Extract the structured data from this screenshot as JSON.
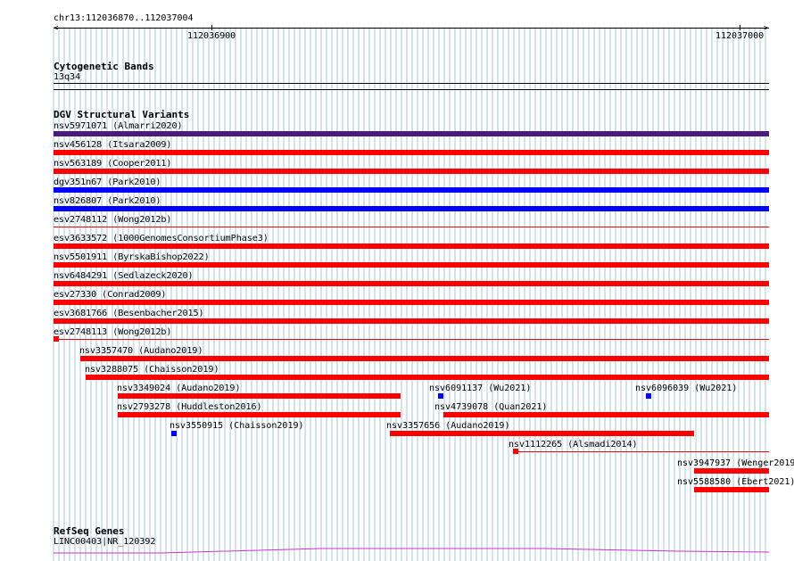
{
  "ruler": {
    "region": "chr13:112036870..112037004",
    "start_label": "112036900",
    "end_label": "112037000"
  },
  "cytoband": {
    "title": "Cytogenetic Bands",
    "band": "13q34"
  },
  "dgv": {
    "title": "DGV Structural Variants",
    "variants": [
      {
        "id": "nsv5971071",
        "study": "Almarri2020",
        "label": "nsv5971071 (Almarri2020)",
        "color": "#4b1a7a",
        "start": 112036870,
        "end": 112037004
      },
      {
        "id": "nsv456128",
        "study": "Itsara2009",
        "label": "nsv456128 (Itsara2009)",
        "color": "#ff0000",
        "start": 112036870,
        "end": 112037004
      },
      {
        "id": "nsv563189",
        "study": "Cooper2011",
        "label": "nsv563189 (Cooper2011)",
        "color": "#ff0000",
        "start": 112036870,
        "end": 112037004
      },
      {
        "id": "dgv351n67",
        "study": "Park2010",
        "label": "dgv351n67 (Park2010)",
        "color": "#0000ff",
        "start": 112036870,
        "end": 112037004
      },
      {
        "id": "nsv826807",
        "study": "Park2010",
        "label": "nsv826807 (Park2010)",
        "color": "#0000ff",
        "start": 112036870,
        "end": 112037004
      },
      {
        "id": "esv2748112",
        "study": "Wong2012b",
        "label": "esv2748112 (Wong2012b)",
        "color": "#ff0000",
        "start": 112036870,
        "end": 112037004,
        "thin": true
      },
      {
        "id": "esv3633572",
        "study": "1000GenomesConsortiumPhase3",
        "label": "esv3633572 (1000GenomesConsortiumPhase3)",
        "color": "#ff0000",
        "start": 112036870,
        "end": 112037004
      },
      {
        "id": "nsv5501911",
        "study": "ByrskaBishop2022",
        "label": "nsv5501911 (ByrskaBishop2022)",
        "color": "#ff0000",
        "start": 112036870,
        "end": 112037004
      },
      {
        "id": "nsv6484291",
        "study": "Sedlazeck2020",
        "label": "nsv6484291 (Sedlazeck2020)",
        "color": "#ff0000",
        "start": 112036870,
        "end": 112037004
      },
      {
        "id": "esv27330",
        "study": "Conrad2009",
        "label": "esv27330 (Conrad2009)",
        "color": "#ff0000",
        "start": 112036870,
        "end": 112037004
      },
      {
        "id": "esv3681766",
        "study": "Besenbacher2015",
        "label": "esv3681766 (Besenbacher2015)",
        "color": "#ff0000",
        "start": 112036870,
        "end": 112037004
      },
      {
        "id": "esv2748113",
        "study": "Wong2012b",
        "label": "esv2748113 (Wong2012b)",
        "color": "#ff0000",
        "start": 112036870,
        "end": 112037004,
        "thin": true,
        "stub": 112036871
      },
      {
        "id": "nsv3357470",
        "study": "Audano2019",
        "label": "nsv3357470 (Audano2019)",
        "color": "#ff0000",
        "start": 112036875,
        "end": 112037004
      },
      {
        "id": "nsv3288075",
        "study": "Chaisson2019",
        "label": "nsv3288075 (Chaisson2019)",
        "color": "#ff0000",
        "start": 112036876,
        "end": 112037004
      },
      {
        "id": "nsv3349024",
        "study": "Audano2019",
        "label": "nsv3349024 (Audano2019)",
        "color": "#ff0000",
        "start": 112036882,
        "end": 112036935
      },
      {
        "id": "nsv2793278",
        "study": "Huddleston2016",
        "label": "nsv2793278 (Huddleston2016)",
        "color": "#ff0000",
        "start": 112036882,
        "end": 112036935
      },
      {
        "id": "nsv3550915",
        "study": "Chaisson2019",
        "label": "nsv3550915 (Chaisson2019)",
        "color": "#0000ff",
        "start": 112036892,
        "end": 112036893
      },
      {
        "id": "nsv6091137",
        "study": "Wu2021",
        "label": "nsv6091137 (Wu2021)",
        "color": "#0000ff",
        "start": 112036942,
        "end": 112036943
      },
      {
        "id": "nsv4739078",
        "study": "Quan2021",
        "label": "nsv4739078 (Quan2021)",
        "color": "#ff0000",
        "start": 112036943,
        "end": 112037004
      },
      {
        "id": "nsv3357656",
        "study": "Audano2019",
        "label": "nsv3357656 (Audano2019)",
        "color": "#ff0000",
        "start": 112036933,
        "end": 112036990
      },
      {
        "id": "nsv6096039",
        "study": "Wu2021",
        "label": "nsv6096039 (Wu2021)",
        "color": "#0000ff",
        "start": 112036981,
        "end": 112036982
      },
      {
        "id": "nsv1112265",
        "study": "Alsmadi2014",
        "label": "nsv1112265 (Alsmadi2014)",
        "color": "#ff0000",
        "start": 112036956,
        "end": 112037004,
        "thin": true,
        "stub": 112036957
      },
      {
        "id": "nsv3947937",
        "study": "Wenger2019",
        "label": "nsv3947937 (Wenger2019",
        "color": "#ff0000",
        "start": 112036990,
        "end": 112037004
      },
      {
        "id": "nsv5588580",
        "study": "Ebert2021",
        "label": "nsv5588580 (Ebert2021)",
        "color": "#ff0000",
        "start": 112036990,
        "end": 112037004
      }
    ]
  },
  "refseq": {
    "title": "RefSeq Genes",
    "gene": "LINC00403|NR_120392",
    "color": "#cc33cc"
  },
  "colors": {
    "grid": "#a8c8d8",
    "loss": "#ff0000",
    "gain": "#0000ff",
    "complex": "#4b1a7a"
  }
}
